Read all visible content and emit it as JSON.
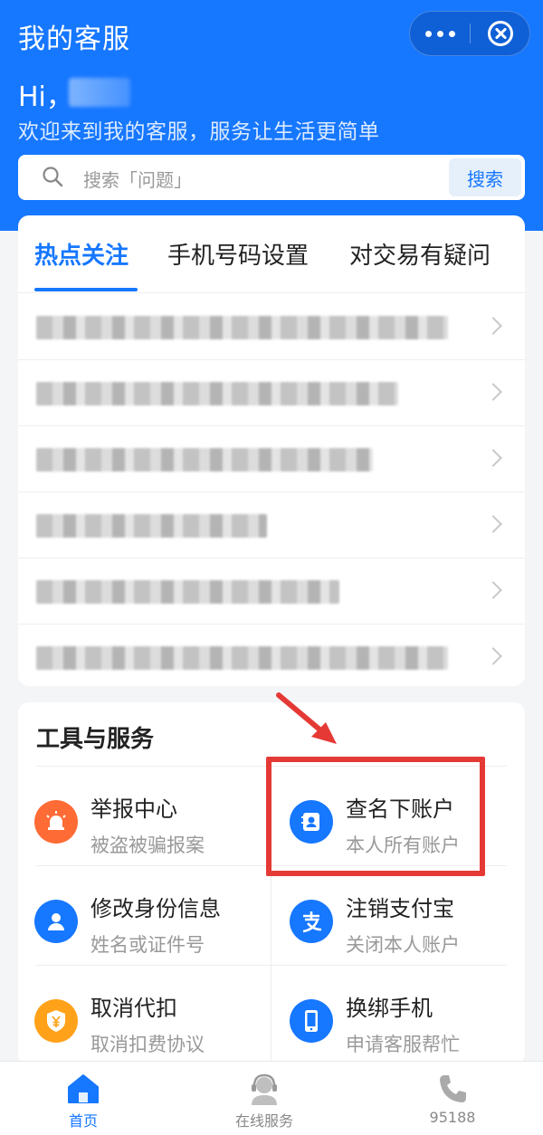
{
  "header": {
    "title": "我的客服",
    "greeting": "Hi，",
    "welcome": "欢迎来到我的客服，服务让生活更简单",
    "capsule": {
      "more_icon": "more-dots-icon",
      "close_icon": "close-circle-icon"
    }
  },
  "search": {
    "placeholder": "搜索「问题」",
    "button_label": "搜索",
    "icon": "search-icon"
  },
  "hot": {
    "tabs": [
      {
        "label": "热点关注",
        "active": true
      },
      {
        "label": "手机号码设置",
        "active": false
      },
      {
        "label": "对交易有疑问",
        "active": false
      }
    ],
    "rows": 6
  },
  "tools": {
    "title": "工具与服务",
    "items": [
      {
        "title": "举报中心",
        "subtitle": "被盗被骗报案",
        "icon": "alarm-icon",
        "color": "#ff6b35"
      },
      {
        "title": "查名下账户",
        "subtitle": "本人所有账户",
        "icon": "contact-card-icon",
        "color": "#1677ff"
      },
      {
        "title": "修改身份信息",
        "subtitle": "姓名或证件号",
        "icon": "user-icon",
        "color": "#1677ff"
      },
      {
        "title": "注销支付宝",
        "subtitle": "关闭本人账户",
        "icon": "alipay-icon",
        "color": "#1677ff"
      },
      {
        "title": "取消代扣",
        "subtitle": "取消扣费协议",
        "icon": "shield-yen-icon",
        "color": "#ffa21a"
      },
      {
        "title": "换绑手机",
        "subtitle": "申请客服帮忙",
        "icon": "phone-device-icon",
        "color": "#1677ff"
      }
    ]
  },
  "tabbar": {
    "items": [
      {
        "label": "首页",
        "icon": "home-icon",
        "active": true
      },
      {
        "label": "在线服务",
        "icon": "headset-agent-icon",
        "active": false
      },
      {
        "label": "95188",
        "icon": "phone-icon",
        "active": false
      }
    ]
  },
  "colors": {
    "primary": "#1677ff",
    "highlight": "#e53935"
  }
}
